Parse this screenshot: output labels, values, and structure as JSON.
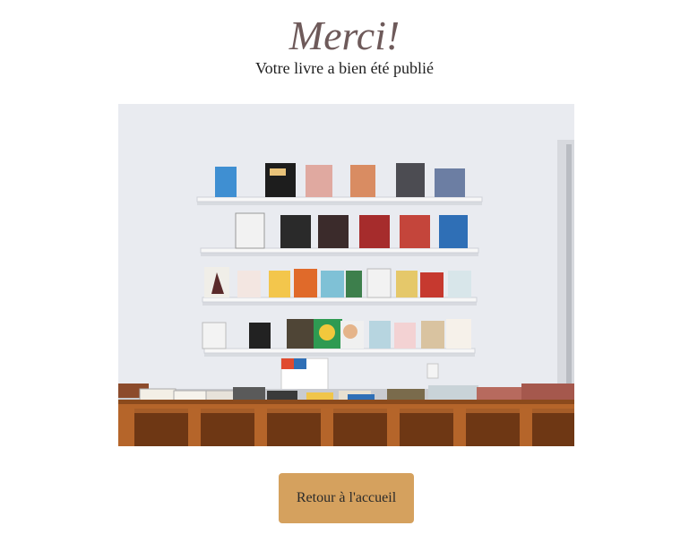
{
  "heading": {
    "title": "Merci!",
    "subtitle": "Votre livre a bien été publié"
  },
  "image": {
    "description_icon": "bookshelf-photo-icon"
  },
  "actions": {
    "home_button_label": "Retour à l'accueil"
  },
  "colors": {
    "title": "#6e5a5a",
    "button": "#d5a15e",
    "shelf_wood": "#b5652a"
  }
}
